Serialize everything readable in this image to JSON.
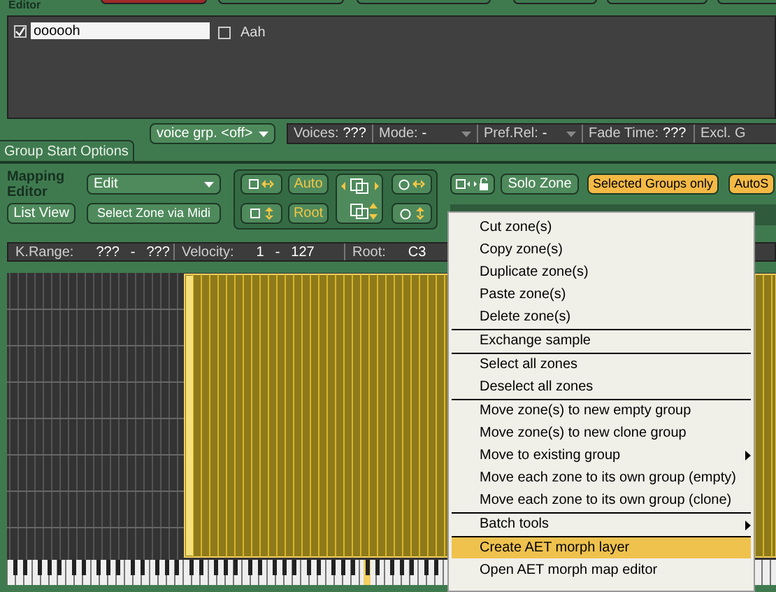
{
  "editor": {
    "title": "Editor"
  },
  "groups": [
    {
      "kind": "field",
      "checked": true,
      "name": "oooooh"
    },
    {
      "kind": "label",
      "checked": false,
      "name": "Aah"
    }
  ],
  "tab": {
    "label": "Group Start Options"
  },
  "voice_group": {
    "value": "voice grp. <off>"
  },
  "group_status": [
    {
      "label": "Voices:",
      "value": "???",
      "dropdown": false
    },
    {
      "label": "Mode:",
      "value": "-",
      "dropdown": true
    },
    {
      "label": "Pref.Rel:",
      "value": "-",
      "dropdown": true
    },
    {
      "label": "Fade Time:",
      "value": "???",
      "dropdown": false
    },
    {
      "label": "Excl. G",
      "dropdown": false
    }
  ],
  "mapping_editor": {
    "title": "Mapping Editor",
    "mode": "Edit",
    "list_view": "List View",
    "select_via_midi": "Select Zone via Midi",
    "auto": "Auto",
    "root": "Root",
    "solo": "Solo Zone",
    "toggles": [
      {
        "label": "Selected Groups only",
        "on": true
      },
      {
        "label": "AutoS",
        "on": true
      }
    ]
  },
  "zone_info": [
    {
      "label": "K.Range:",
      "values": [
        "???",
        "-",
        "???"
      ]
    },
    {
      "label": "Velocity:",
      "values": [
        "1",
        "-",
        "127"
      ]
    },
    {
      "label": "Root:",
      "values": [
        "C3"
      ]
    }
  ],
  "context_menu": [
    {
      "label": "Cut zone(s)",
      "separator_before": false,
      "submenu": false,
      "selected": false
    },
    {
      "label": "Copy zone(s)",
      "separator_before": false,
      "submenu": false,
      "selected": false
    },
    {
      "label": "Duplicate zone(s)",
      "separator_before": false,
      "submenu": false,
      "selected": false
    },
    {
      "label": "Paste zone(s)",
      "separator_before": false,
      "submenu": false,
      "selected": false
    },
    {
      "label": "Delete zone(s)",
      "separator_before": false,
      "submenu": false,
      "selected": false
    },
    {
      "label": "Exchange sample",
      "separator_before": true,
      "submenu": false,
      "selected": false
    },
    {
      "label": "Select all zones",
      "separator_before": true,
      "submenu": false,
      "selected": false
    },
    {
      "label": "Deselect all zones",
      "separator_before": false,
      "submenu": false,
      "selected": false
    },
    {
      "label": "Move zone(s) to new empty group",
      "separator_before": true,
      "submenu": false,
      "selected": false
    },
    {
      "label": "Move zone(s) to new clone group",
      "separator_before": false,
      "submenu": false,
      "selected": false
    },
    {
      "label": "Move to existing group",
      "separator_before": false,
      "submenu": true,
      "selected": false
    },
    {
      "label": "Move each zone to its own group (empty)",
      "separator_before": false,
      "submenu": false,
      "selected": false
    },
    {
      "label": "Move each zone to its own group (clone)",
      "separator_before": false,
      "submenu": false,
      "selected": false
    },
    {
      "label": "Batch tools",
      "separator_before": true,
      "submenu": true,
      "selected": false
    },
    {
      "label": "Create AET morph layer",
      "separator_before": true,
      "submenu": false,
      "selected": true
    },
    {
      "label": "Open AET morph map editor",
      "separator_before": false,
      "submenu": false,
      "selected": false
    }
  ]
}
